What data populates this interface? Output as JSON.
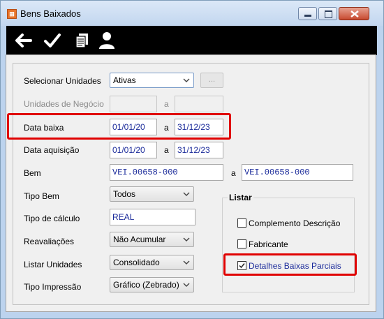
{
  "window": {
    "title": "Bens Baixados"
  },
  "toolbar": {
    "icons": [
      "arrow-left-icon",
      "checkmark-icon",
      "copy-icon",
      "user-icon"
    ]
  },
  "form": {
    "selecionar_unidades": {
      "label": "Selecionar Unidades",
      "value": "Ativas",
      "button": "..."
    },
    "unidades_negocio": {
      "label": "Unidades de Negócio",
      "sep": "a"
    },
    "data_baixa": {
      "label": "Data baixa",
      "from": "01/01/20",
      "sep": "a",
      "to": "31/12/23"
    },
    "data_aquisicao": {
      "label": "Data aquisição",
      "from": "01/01/20",
      "sep": "a",
      "to": "31/12/23"
    },
    "bem": {
      "label": "Bem",
      "from": "VEI.00658-000",
      "sep": "a",
      "to": "VEI.00658-000"
    },
    "tipo_bem": {
      "label": "Tipo Bem",
      "value": "Todos"
    },
    "tipo_calculo": {
      "label": "Tipo de cálculo",
      "value": "REAL"
    },
    "reavaliacoes": {
      "label": "Reavaliações",
      "value": "Não Acumular"
    },
    "listar_unidades": {
      "label": "Listar Unidades",
      "value": "Consolidado"
    },
    "tipo_impressao": {
      "label": "Tipo Impressão",
      "value": "Gráfico (Zebrado)"
    }
  },
  "listar": {
    "title": "Listar",
    "options": [
      {
        "label": "Complemento Descrição",
        "checked": false
      },
      {
        "label": "Fabricante",
        "checked": false
      },
      {
        "label": "Detalhes Baixas Parciais",
        "checked": true
      }
    ]
  },
  "colors": {
    "highlight": "#e00000",
    "toolbar_bg": "#000000",
    "value_text": "#1a2a9a"
  }
}
